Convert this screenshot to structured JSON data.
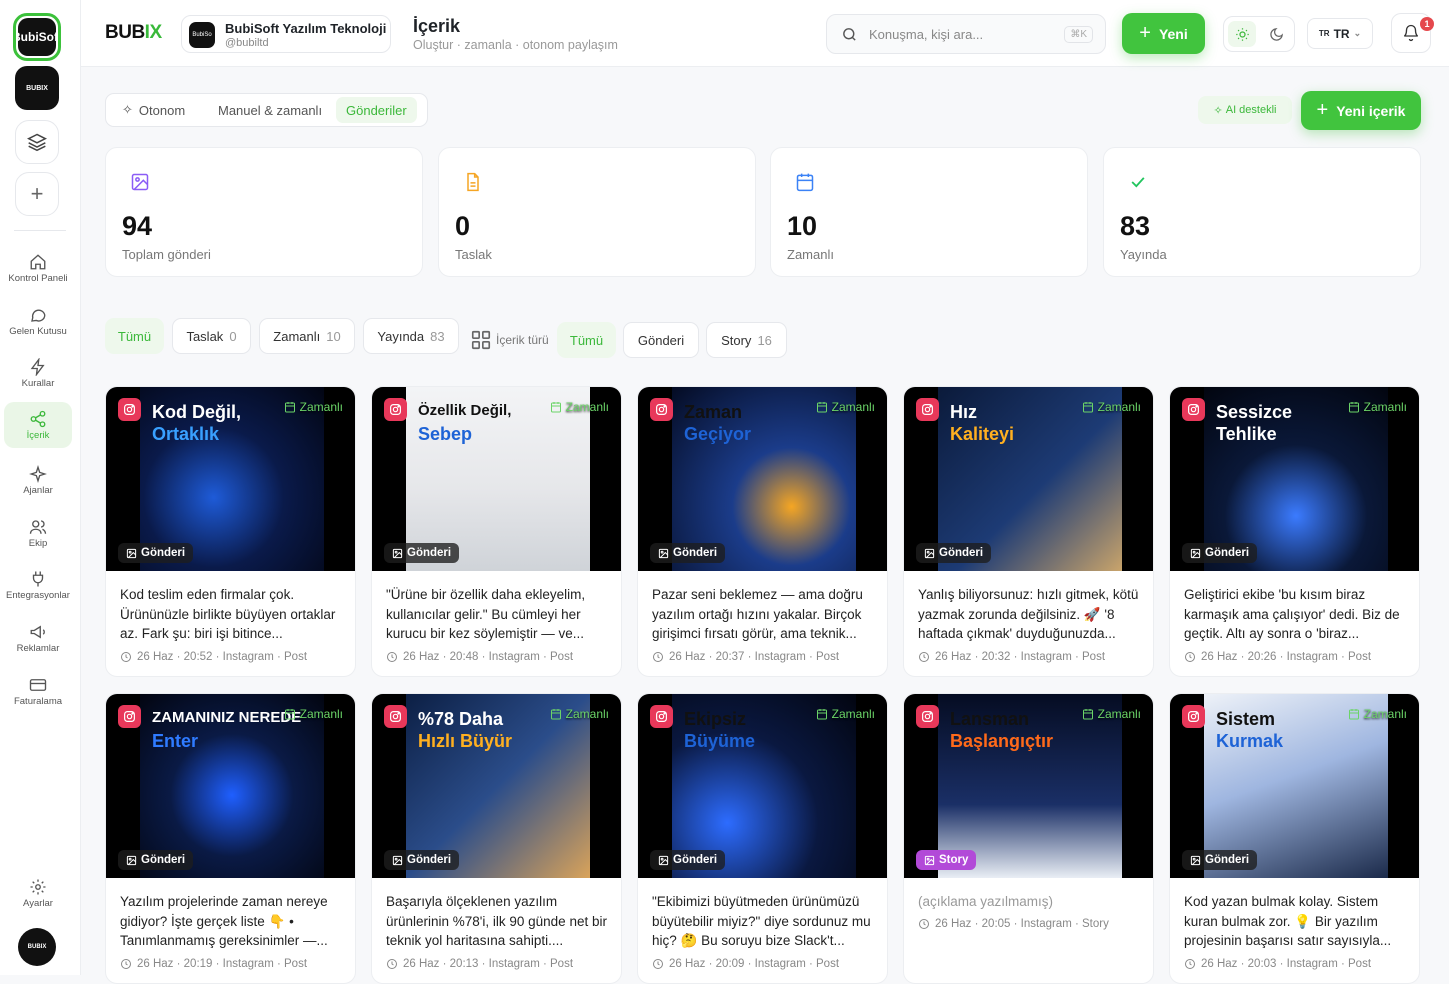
{
  "rail": {
    "workspace_active": "BubiSoft",
    "workspace_logo": "BUBIX",
    "items": [
      {
        "label": "Kontrol Paneli",
        "icon": "home-icon"
      },
      {
        "label": "Gelen Kutusu",
        "icon": "chat-icon"
      },
      {
        "label": "Kurallar",
        "icon": "bolt-icon"
      },
      {
        "label": "İçerik",
        "icon": "share-icon"
      },
      {
        "label": "Ajanlar",
        "icon": "sparkle-icon"
      },
      {
        "label": "Ekip",
        "icon": "users-icon"
      },
      {
        "label": "Entegrasyonlar",
        "icon": "plug-icon"
      },
      {
        "label": "Reklamlar",
        "icon": "megaphone-icon"
      },
      {
        "label": "Faturalama",
        "icon": "card-icon"
      }
    ],
    "settings_label": "Ayarlar",
    "bottom_logo": "BUBIX"
  },
  "header": {
    "brand_main": "BUB",
    "brand_accent": "IX",
    "org_name": "BubiSoft Yazılım Teknoloji",
    "org_handle": "@bubiltd",
    "org_logo": "BubiSo",
    "page_title": "İçerik",
    "page_subtitle": "Oluştur · zamanla · otonom paylaşım",
    "search_placeholder": "Konuşma, kişi ara...",
    "search_shortcut": "⌘K",
    "new_label": "Yeni",
    "lang_flag": "TR",
    "lang_label": "TR",
    "notif_count": "1"
  },
  "tabs": [
    "Otonom",
    "Manuel & zamanlı",
    "Gönderiler"
  ],
  "ai_label": "AI destekli",
  "new_content_label": "Yeni içerik",
  "stats": [
    {
      "value": "94",
      "label": "Toplam gönderi",
      "icon": "image-icon",
      "color": "#8b5cf6"
    },
    {
      "value": "0",
      "label": "Taslak",
      "icon": "document-icon",
      "color": "#f5a524"
    },
    {
      "value": "10",
      "label": "Zamanlı",
      "icon": "calendar-icon",
      "color": "#3b82f6"
    },
    {
      "value": "83",
      "label": "Yayında",
      "icon": "check-icon",
      "color": "#22c55e"
    }
  ],
  "status_filters": [
    {
      "label": "Tümü",
      "count": ""
    },
    {
      "label": "Taslak",
      "count": "0"
    },
    {
      "label": "Zamanlı",
      "count": "10"
    },
    {
      "label": "Yayında",
      "count": "83"
    }
  ],
  "type_label": "İçerik türü",
  "type_filters": [
    {
      "label": "Tümü",
      "count": ""
    },
    {
      "label": "Gönderi",
      "count": ""
    },
    {
      "label": "Story",
      "count": "16"
    }
  ],
  "scheduled_label": "Zamanlı",
  "posts": [
    {
      "kind": "Gönderi",
      "caption": "Kod teslim eden firmalar çok. Ürününüzle birlikte büyüyen ortaklar az. Fark şu: biri işi bitince...",
      "meta": "26 Haz · 20:52 · Instagram · Post",
      "t1": "Kod Değil,",
      "t2": "Ortaklık"
    },
    {
      "kind": "Gönderi",
      "caption": "\"Ürüne bir özellik daha ekleyelim, kullanıcılar gelir.\" Bu cümleyi her kurucu bir kez söylemiştir — ve...",
      "meta": "26 Haz · 20:48 · Instagram · Post",
      "t1": "Özellik Değil,",
      "t2": "Sebep"
    },
    {
      "kind": "Gönderi",
      "caption": "Pazar seni beklemez — ama doğru yazılım ortağı hızını yakalar. Birçok girişimci fırsatı görür, ama teknik...",
      "meta": "26 Haz · 20:37 · Instagram · Post",
      "t1": "Zaman",
      "t2": "Geçiyor"
    },
    {
      "kind": "Gönderi",
      "caption": "Yanlış biliyorsunuz: hızlı gitmek, kötü yazmak zorunda değilsiniz. 🚀 '8 haftada çıkmak' duyduğunuzda...",
      "meta": "26 Haz · 20:32 · Instagram · Post",
      "t1": "Hız",
      "t2": "Kaliteyi"
    },
    {
      "kind": "Gönderi",
      "caption": "Geliştirici ekibe 'bu kısım biraz karmaşık ama çalışıyor' dedi. Biz de geçtik. Altı ay sonra o 'biraz...",
      "meta": "26 Haz · 20:26 · Instagram · Post",
      "t1": "Sessizce",
      "t2": "Tehlike"
    },
    {
      "kind": "Gönderi",
      "caption": "Yazılım projelerinde zaman nereye gidiyor? İşte gerçek liste 👇 • Tanımlanmamış gereksinimler —...",
      "meta": "26 Haz · 20:19 · Instagram · Post",
      "t1": "ZAMANINIZ NEREDE",
      "t2": "Enter"
    },
    {
      "kind": "Gönderi",
      "caption": "Başarıyla ölçeklenen yazılım ürünlerinin %78'i, ilk 90 günde net bir teknik yol haritasına sahipti....",
      "meta": "26 Haz · 20:13 · Instagram · Post",
      "t1": "%78 Daha",
      "t2": "Hızlı Büyür"
    },
    {
      "kind": "Gönderi",
      "caption": "\"Ekibimizi büyütmeden ürünümüzü büyütebilir miyiz?\" diye sordunuz mu hiç? 🤔 Bu soruyu bize Slack't...",
      "meta": "26 Haz · 20:09 · Instagram · Post",
      "t1": "Ekipsiz",
      "t2": "Büyüme"
    },
    {
      "kind": "Story",
      "caption": "(açıklama yazılmamış)",
      "meta": "26 Haz · 20:05 · Instagram · Story",
      "t1": "Lansman",
      "t2": "Başlangıçtır"
    },
    {
      "kind": "Gönderi",
      "caption": "Kod yazan bulmak kolay. Sistem kuran bulmak zor. 💡 Bir yazılım projesinin başarısı satır sayısıyla...",
      "meta": "26 Haz · 20:03 · Instagram · Post",
      "t1": "Sistem",
      "t2": "Kurmak"
    }
  ]
}
